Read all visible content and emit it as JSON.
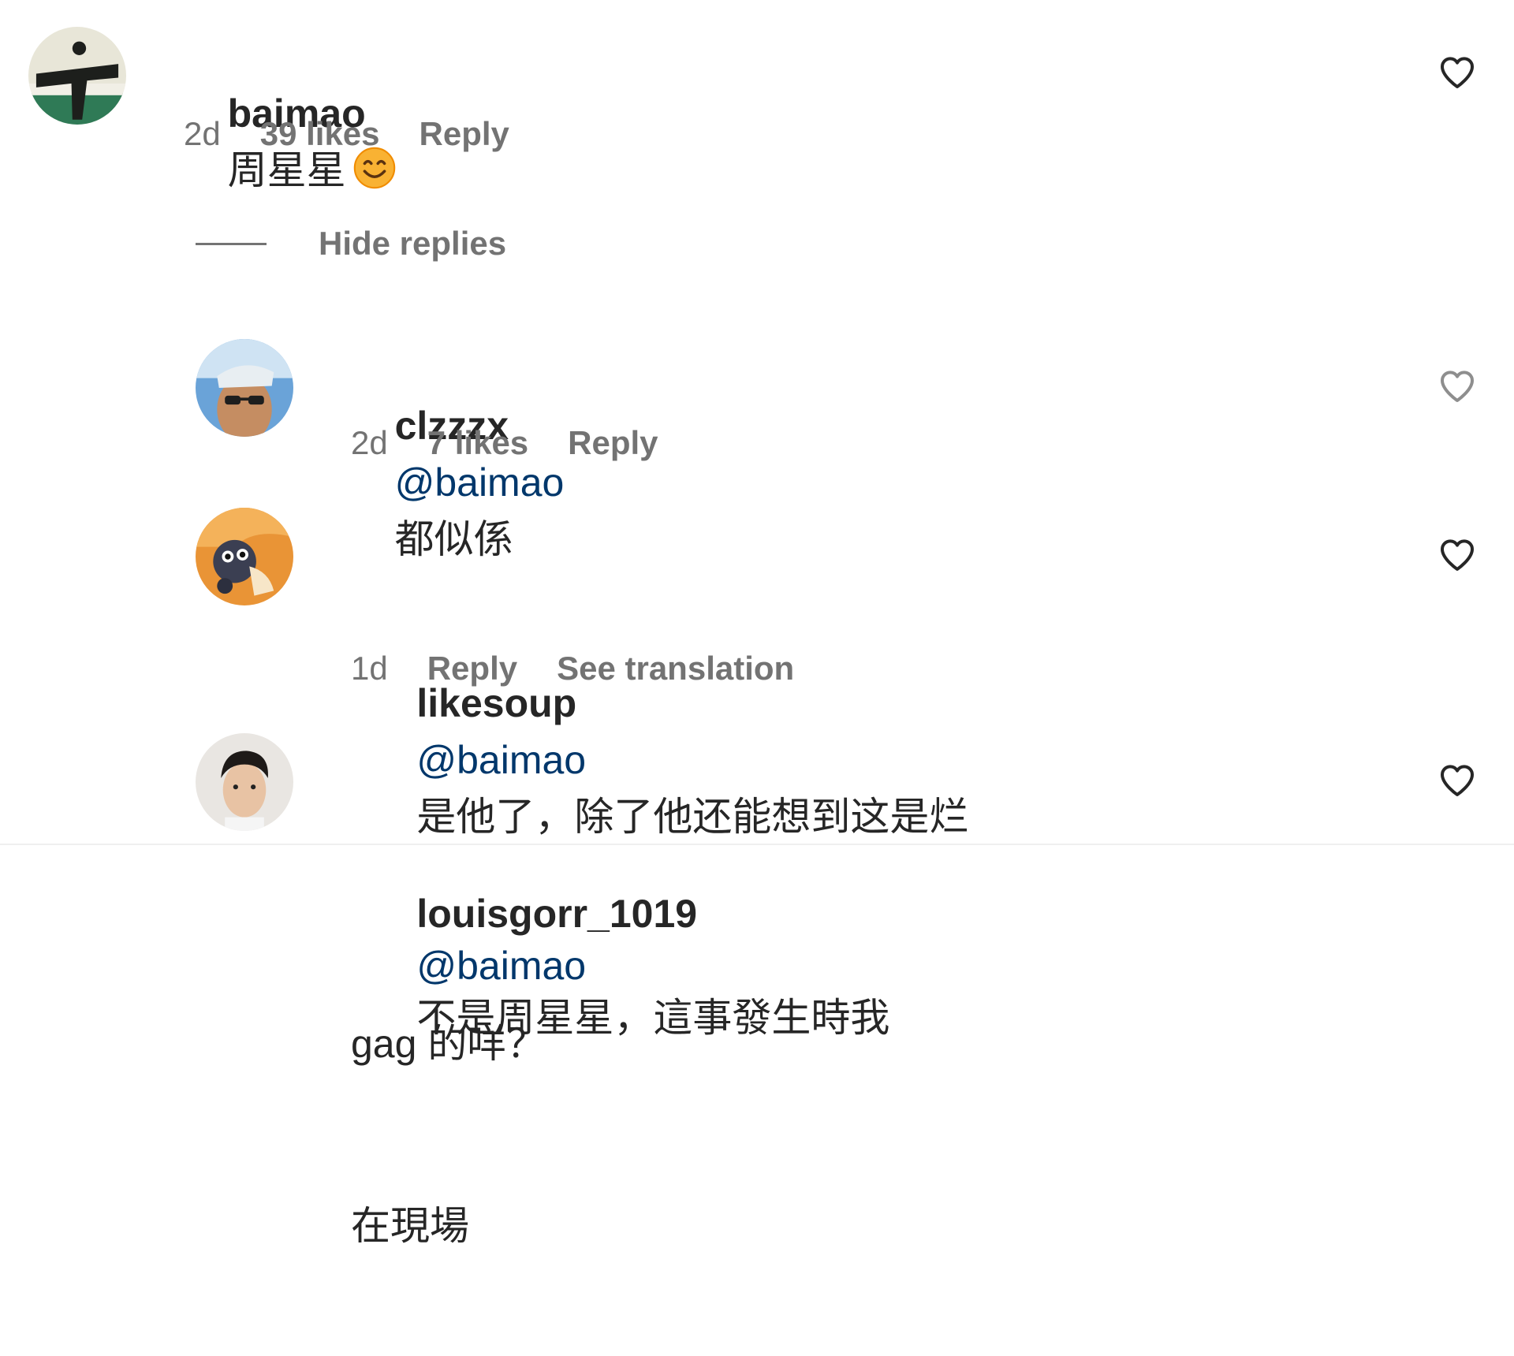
{
  "comments": [
    {
      "username": "baimao",
      "text": "周星星",
      "emoji": "smiling-face-emoji",
      "time": "2d",
      "likes": "39 likes",
      "reply_label": "Reply"
    }
  ],
  "hide_replies_label": "Hide replies",
  "replies": [
    {
      "username": "clzzzx",
      "mention": "@baimao",
      "text": "都似係",
      "time": "2d",
      "likes": "7 likes",
      "reply_label": "Reply"
    },
    {
      "username": "likesoup",
      "mention": "@baimao",
      "text": "是他了，除了他还能想到这是烂gag 的咩？",
      "line1": "是他了，除了他还能想到这是烂",
      "line2": "gag 的咩？",
      "time": "1d",
      "reply_label": "Reply",
      "translation_label": "See translation"
    },
    {
      "username": "louisgorr_1019",
      "mention": "@baimao",
      "line1": "不是周星星，這事發生時我",
      "line2": "在現場"
    }
  ],
  "icons": {
    "heart": "heart-outline-icon"
  },
  "colors": {
    "text": "#262626",
    "secondary": "#737373",
    "mention": "#00376b"
  }
}
